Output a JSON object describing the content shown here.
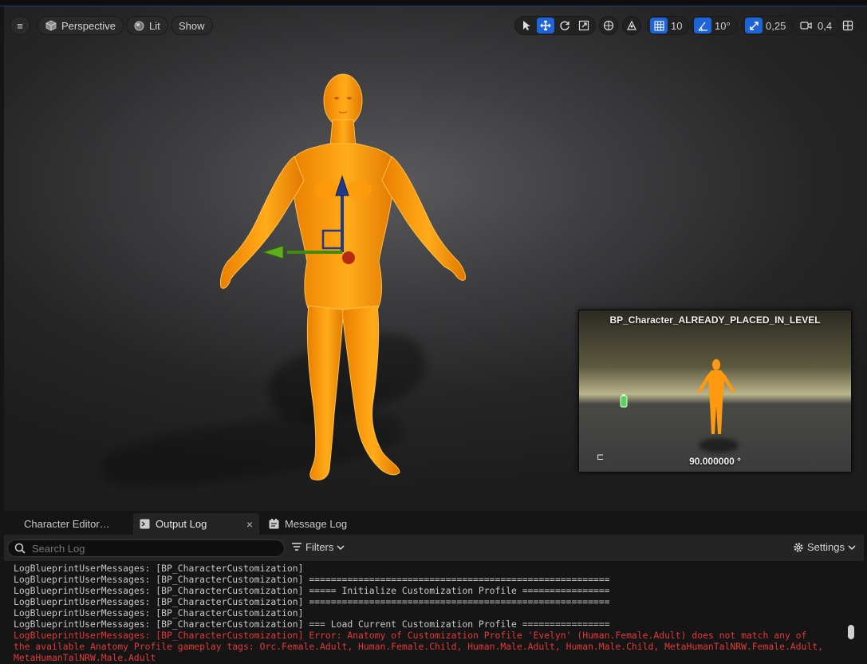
{
  "toolbar": {
    "view_mode": "Perspective",
    "lighting": "Lit",
    "show": "Show",
    "grid_snap": "10",
    "rotation_snap": "10°",
    "scale_snap": "0,25",
    "camera_speed": "0,4",
    "accent_color": "#1e64d6"
  },
  "pip": {
    "title": "BP_Character_ALREADY_PLACED_IN_LEVEL",
    "angle": "90.000000 °"
  },
  "tabs": [
    {
      "label": "Character Editor…",
      "icon": "none"
    },
    {
      "label": "Output Log",
      "icon": "terminal-icon",
      "close": "×"
    },
    {
      "label": "Message Log",
      "icon": "message-icon"
    }
  ],
  "log": {
    "search_placeholder": "Search Log",
    "filters_label": "Filters",
    "settings_label": "Settings",
    "error_color": "#e03a3a",
    "lines": [
      {
        "text": "LogBlueprintUserMessages: [BP_CharacterCustomization]",
        "type": "normal"
      },
      {
        "text": "LogBlueprintUserMessages: [BP_CharacterCustomization] =======================================================",
        "type": "normal"
      },
      {
        "text": "LogBlueprintUserMessages: [BP_CharacterCustomization] ===== Initialize Customization Profile ================",
        "type": "normal"
      },
      {
        "text": "LogBlueprintUserMessages: [BP_CharacterCustomization] =======================================================",
        "type": "normal"
      },
      {
        "text": "LogBlueprintUserMessages: [BP_CharacterCustomization]",
        "type": "normal"
      },
      {
        "text": "LogBlueprintUserMessages: [BP_CharacterCustomization] === Load Current Customization Profile ================",
        "type": "normal"
      },
      {
        "text": "LogBlueprintUserMessages: [BP_CharacterCustomization] Error: Anatomy of Customization Profile 'Evelyn' (Human.Female.Adult) does not match any of",
        "type": "error"
      },
      {
        "text": "the available Anatomy Profile gameplay tags: Orc.Female.Adult, Human.Female.Child, Human.Male.Adult, Human.Male.Child, MetaHumanTalNRW.Female.Adult,",
        "type": "error"
      },
      {
        "text": "MetaHumanTalNRW.Male.Adult",
        "type": "error"
      }
    ]
  }
}
